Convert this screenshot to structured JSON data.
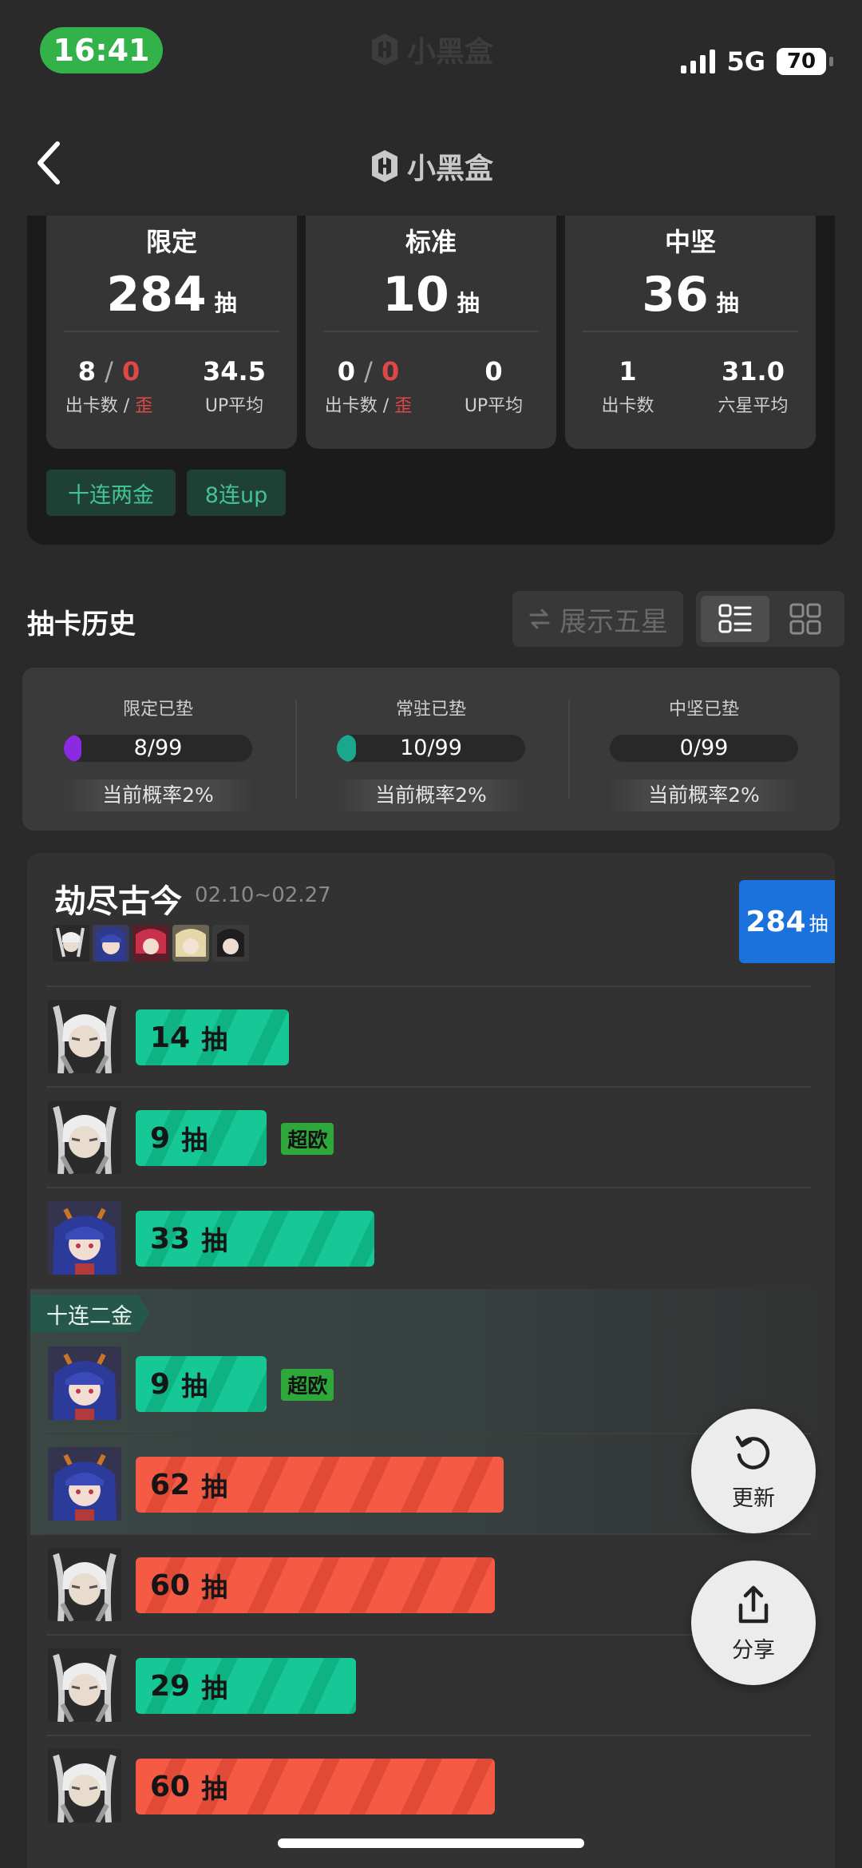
{
  "status": {
    "time": "16:41",
    "network": "5G",
    "battery": "70"
  },
  "app": {
    "name": "小黑盒"
  },
  "summary": {
    "cards": [
      {
        "title": "限定",
        "total": "284",
        "unit": "抽",
        "left_value_a": "8",
        "left_value_b": "0",
        "left_label_a": "出卡数",
        "left_label_b": "歪",
        "right_value": "34.5",
        "right_label": "UP平均"
      },
      {
        "title": "标准",
        "total": "10",
        "unit": "抽",
        "left_value_a": "0",
        "left_value_b": "0",
        "left_label_a": "出卡数",
        "left_label_b": "歪",
        "right_value": "0",
        "right_label": "UP平均"
      },
      {
        "title": "中坚",
        "total": "36",
        "unit": "抽",
        "left_value_a": "1",
        "left_value_b": "",
        "left_label_a": "出卡数",
        "left_label_b": "",
        "right_value": "31.0",
        "right_label": "六星平均"
      }
    ],
    "tags": [
      "十连两金",
      "8连up"
    ]
  },
  "history": {
    "title": "抽卡历史",
    "show_five_star_label": "展示五星"
  },
  "pity": [
    {
      "label": "限定已垫",
      "value": "8/99",
      "progress": 0.081,
      "color": "#8a2be2",
      "rate": "当前概率2%"
    },
    {
      "label": "常驻已垫",
      "value": "10/99",
      "progress": 0.101,
      "color": "#1aa88c",
      "rate": "当前概率2%"
    },
    {
      "label": "中坚已垫",
      "value": "0/99",
      "progress": 0,
      "color": "#1aa88c",
      "rate": "当前概率2%"
    }
  ],
  "banner": {
    "name": "劫尽古今",
    "date": "02.10~02.27",
    "total": "284",
    "total_unit": "抽",
    "group_label": "十连二金",
    "pulls": [
      {
        "count": "14",
        "unit": "抽",
        "char": "white",
        "color": "green",
        "badge": ""
      },
      {
        "count": "9",
        "unit": "抽",
        "char": "white",
        "color": "green",
        "badge": "超欧"
      },
      {
        "count": "33",
        "unit": "抽",
        "char": "blue",
        "color": "green",
        "badge": ""
      },
      {
        "count": "9",
        "unit": "抽",
        "char": "blue",
        "color": "green",
        "badge": "超欧"
      },
      {
        "count": "62",
        "unit": "抽",
        "char": "blue",
        "color": "red",
        "badge": ""
      },
      {
        "count": "60",
        "unit": "抽",
        "char": "white",
        "color": "red",
        "badge": ""
      },
      {
        "count": "29",
        "unit": "抽",
        "char": "white",
        "color": "green",
        "badge": ""
      },
      {
        "count": "60",
        "unit": "抽",
        "char": "white",
        "color": "red",
        "badge": ""
      }
    ]
  },
  "actions": {
    "refresh": "更新",
    "share": "分享"
  }
}
